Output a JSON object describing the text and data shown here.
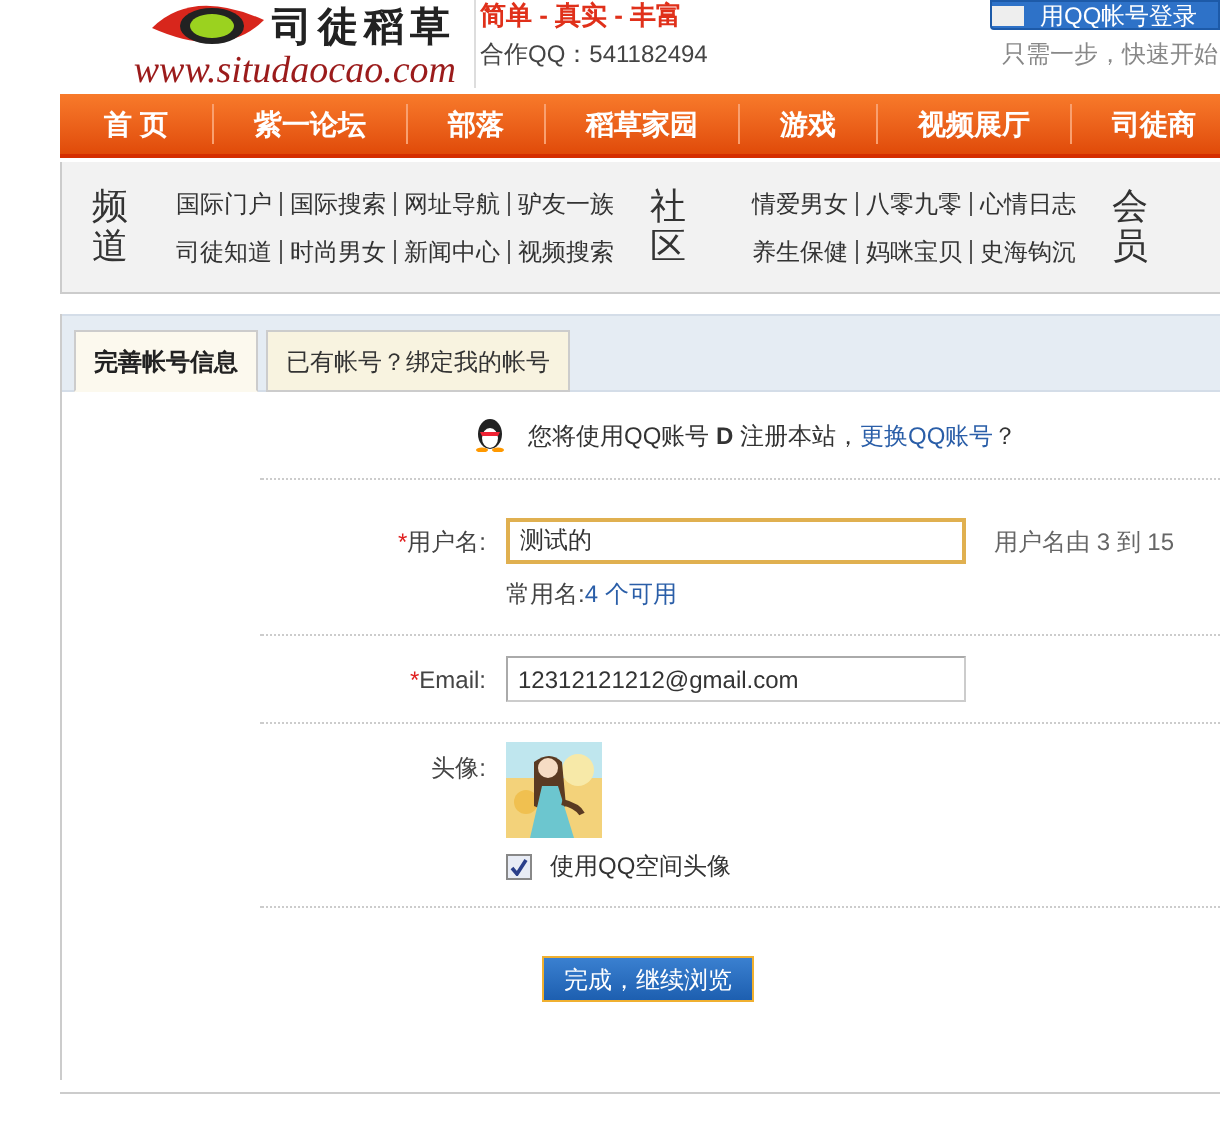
{
  "header": {
    "logo_title": "司徒稻草",
    "logo_url": "www.situdaocao.com",
    "slogan": "简单 - 真实 - 丰富",
    "partner_qq": "合作QQ：541182494",
    "qq_login_button": "用QQ帐号登录",
    "tagline": "只需一步，快速开始"
  },
  "nav": [
    {
      "label": "首 页"
    },
    {
      "label": "紫一论坛"
    },
    {
      "label": "部落"
    },
    {
      "label": "稻草家园"
    },
    {
      "label": "游戏"
    },
    {
      "label": "视频展厅"
    },
    {
      "label": "司徒商"
    }
  ],
  "channel_groups": [
    {
      "heading": "频道",
      "rows": [
        [
          "国际门户",
          "国际搜索",
          "网址导航",
          "驴友一族"
        ],
        [
          "司徒知道",
          "时尚男女",
          "新闻中心",
          "视频搜索"
        ]
      ]
    },
    {
      "heading": "社区",
      "rows": [
        [
          "情爱男女",
          "八零九零",
          "心情日志"
        ],
        [
          "养生保健",
          "妈咪宝贝",
          "史海钩沉"
        ]
      ]
    }
  ],
  "member_heading": "会员",
  "tabs": [
    {
      "label": "完善帐号信息",
      "selected": true
    },
    {
      "label": "已有帐号？绑定我的帐号",
      "selected": false
    }
  ],
  "notice": {
    "text": "您将使用QQ账号 **D** 注册本站，",
    "link": "更换QQ账号",
    "end": "？"
  },
  "fields": [
    {
      "kind": "text",
      "label": "用户名:",
      "required": true,
      "required_mark": "*",
      "value": "测试的",
      "focused": true,
      "hint": "用户名由 3 到 15",
      "suggest_label": "常用名:",
      "suggest_link": "4 个可用"
    },
    {
      "kind": "text",
      "label": "Email:",
      "required": true,
      "required_mark": "*",
      "value": "12312121212@gmail.com",
      "focused": false
    },
    {
      "kind": "avatar",
      "label": "头像:",
      "checkbox": {
        "label": "使用QQ空间头像",
        "checked": true
      }
    }
  ],
  "submit_button": "完成，继续浏览"
}
